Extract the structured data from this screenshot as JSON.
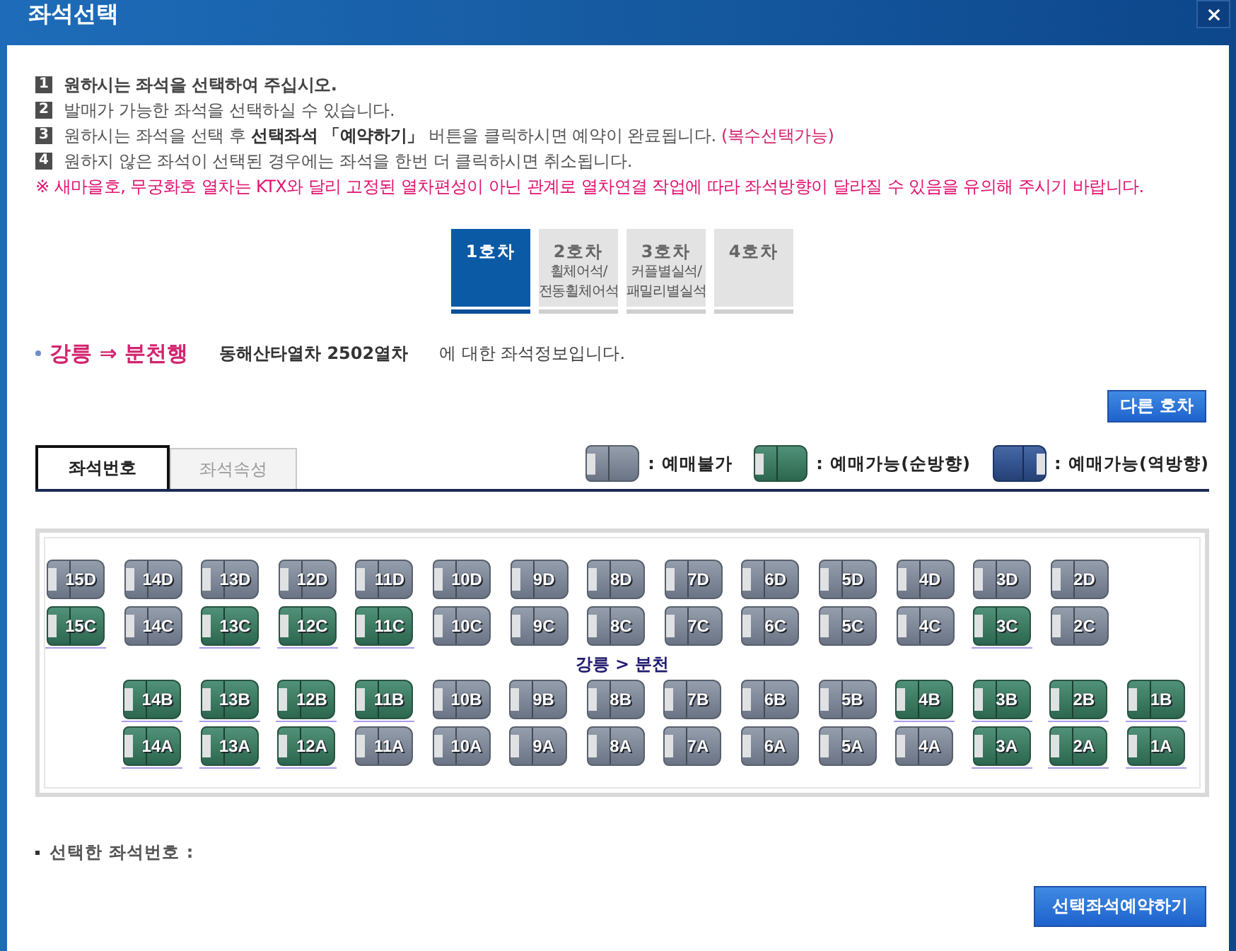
{
  "window": {
    "title": "좌석선택"
  },
  "instructions": [
    {
      "number": "1",
      "text": "원하시는 좌석을 선택하여 주십시오.",
      "bold": true
    },
    {
      "number": "2",
      "text": "발매가 가능한 좌석을 선택하실 수 있습니다.",
      "bold": false
    },
    {
      "number": "3",
      "text": "원하시는 좌석을 선택 후 **선택좌석 「예약하기」** 버튼을 클릭하시면 예약이 완료됩니다.",
      "note": "(복수선택가능)",
      "bold": false
    },
    {
      "number": "4",
      "text": "원하지 않은 좌석이 선택된 경우에는 좌석을 한번 더 클릭하시면 취소됩니다.",
      "bold": false
    }
  ],
  "warning": "※ 새마을호, 무궁화호 열차는 KTX와 달리 고정된 열차편성이 아닌 관계로 열차연결 작업에 따라 좌석방향이 달라질 수 있음을 유의해 주시기 바랍니다.",
  "car_tabs": [
    {
      "label": "1호차",
      "selected": true
    },
    {
      "label": "2호차",
      "lines": [
        "휠체어석/",
        "전동휠체어석"
      ],
      "selected": false
    },
    {
      "label": "3호차",
      "lines": [
        "커플별실석/",
        "패밀리별실석"
      ],
      "selected": false
    },
    {
      "label": "4호차",
      "selected": false
    }
  ],
  "route": {
    "direction": "강릉 ⇒ 분천행",
    "train": "동해산타열차 2502열차",
    "suffix": "에 대한 좌석정보입니다."
  },
  "other_car_button": "다른 호차",
  "view_tabs": [
    {
      "label": "좌석번호",
      "selected": true
    },
    {
      "label": "좌석속성",
      "selected": false
    }
  ],
  "legend": [
    {
      "kind": "unavailable",
      "label": ": 예매불가"
    },
    {
      "kind": "forward",
      "label": ": 예매가능(순방향)"
    },
    {
      "kind": "reverse",
      "label": ": 예매가능(역방향)"
    }
  ],
  "seat_map": {
    "upper_rows": [
      {
        "seats": [
          {
            "label": "15D",
            "available": false
          },
          {
            "label": "14D",
            "available": false
          },
          {
            "label": "13D",
            "available": false
          },
          {
            "label": "12D",
            "available": false
          },
          {
            "label": "11D",
            "available": false
          },
          {
            "label": "10D",
            "available": false
          },
          {
            "label": "9D",
            "available": false
          },
          {
            "label": "8D",
            "available": false
          },
          {
            "label": "7D",
            "available": false
          },
          {
            "label": "6D",
            "available": false
          },
          {
            "label": "5D",
            "available": false
          },
          {
            "label": "4D",
            "available": false
          },
          {
            "label": "3D",
            "available": false
          },
          {
            "label": "2D",
            "available": false
          }
        ]
      },
      {
        "seats": [
          {
            "label": "15C",
            "available": true
          },
          {
            "label": "14C",
            "available": false
          },
          {
            "label": "13C",
            "available": true
          },
          {
            "label": "12C",
            "available": true
          },
          {
            "label": "11C",
            "available": true
          },
          {
            "label": "10C",
            "available": false
          },
          {
            "label": "9C",
            "available": false
          },
          {
            "label": "8C",
            "available": false
          },
          {
            "label": "7C",
            "available": false
          },
          {
            "label": "6C",
            "available": false
          },
          {
            "label": "5C",
            "available": false
          },
          {
            "label": "4C",
            "available": false
          },
          {
            "label": "3C",
            "available": true
          },
          {
            "label": "2C",
            "available": false
          }
        ]
      }
    ],
    "aisle_label": "강릉 > 분천",
    "lower_rows": [
      {
        "seats": [
          {
            "label": "14B",
            "available": true
          },
          {
            "label": "13B",
            "available": true
          },
          {
            "label": "12B",
            "available": true
          },
          {
            "label": "11B",
            "available": true
          },
          {
            "label": "10B",
            "available": false
          },
          {
            "label": "9B",
            "available": false
          },
          {
            "label": "8B",
            "available": false
          },
          {
            "label": "7B",
            "available": false
          },
          {
            "label": "6B",
            "available": false
          },
          {
            "label": "5B",
            "available": false
          },
          {
            "label": "4B",
            "available": true
          },
          {
            "label": "3B",
            "available": true
          },
          {
            "label": "2B",
            "available": true
          },
          {
            "label": "1B",
            "available": true
          }
        ]
      },
      {
        "seats": [
          {
            "label": "14A",
            "available": true
          },
          {
            "label": "13A",
            "available": true
          },
          {
            "label": "12A",
            "available": true
          },
          {
            "label": "11A",
            "available": false
          },
          {
            "label": "10A",
            "available": false
          },
          {
            "label": "9A",
            "available": false
          },
          {
            "label": "8A",
            "available": false
          },
          {
            "label": "7A",
            "available": false
          },
          {
            "label": "6A",
            "available": false
          },
          {
            "label": "5A",
            "available": false
          },
          {
            "label": "4A",
            "available": false
          },
          {
            "label": "3A",
            "available": true
          },
          {
            "label": "2A",
            "available": true
          },
          {
            "label": "1A",
            "available": true
          }
        ]
      }
    ]
  },
  "selected_seats_label": "선택한 좌석번호 :",
  "reserve_button": "선택좌석예약하기"
}
